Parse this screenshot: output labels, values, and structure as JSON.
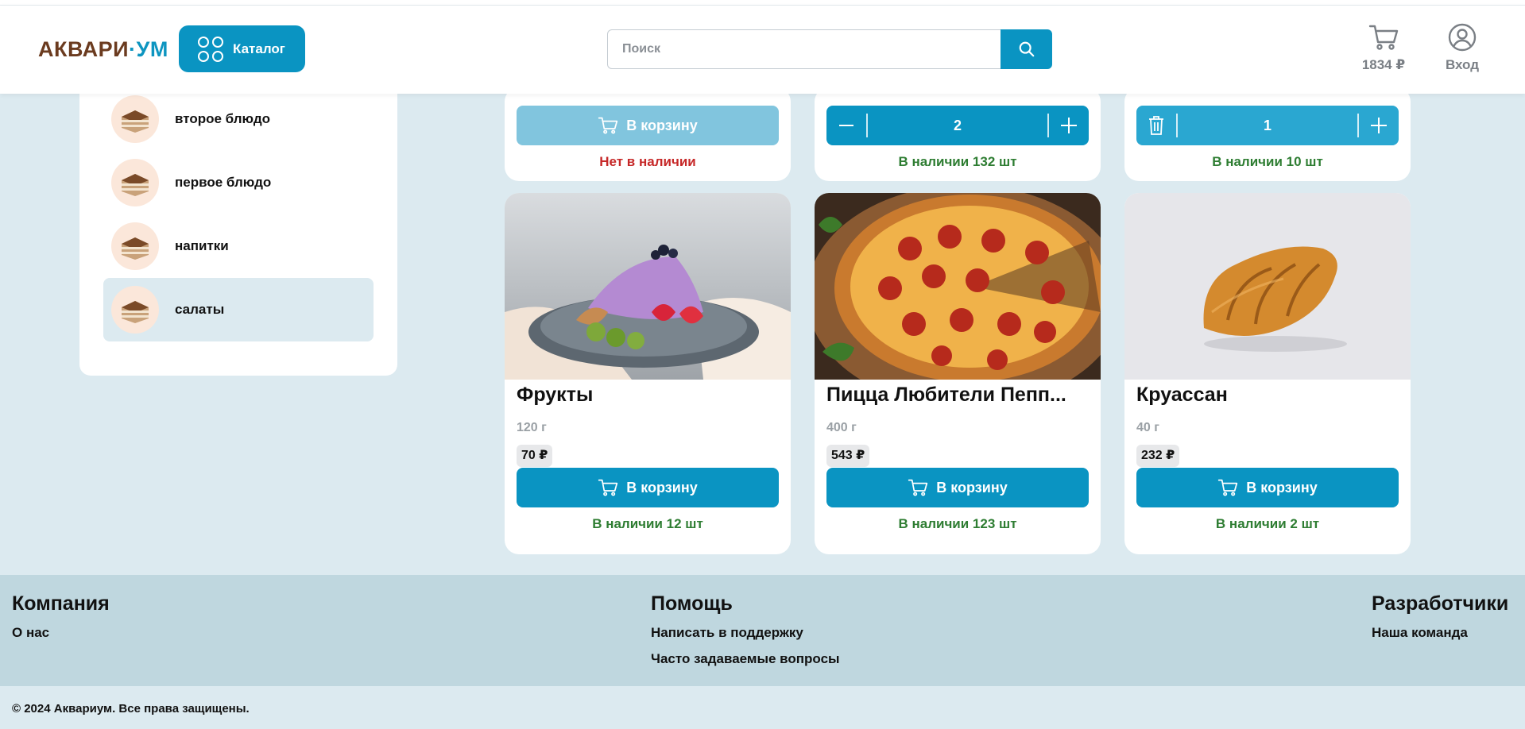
{
  "header": {
    "logo_part1": "АКВАРИ",
    "logo_dot": "·",
    "logo_part2": "УМ",
    "catalog_label": "Каталог",
    "search_placeholder": "Поиск",
    "cart_total": "1834 ₽",
    "login_label": "Вход",
    "colors": {
      "accent": "#0a94c2",
      "logo_brown": "#6b3b1f"
    }
  },
  "sidebar": {
    "items": [
      {
        "label": "второе блюдо",
        "icon": "tiramisu-thumb-icon",
        "active": false
      },
      {
        "label": "первое блюдо",
        "icon": "tiramisu-thumb-icon",
        "active": false
      },
      {
        "label": "напитки",
        "icon": "tiramisu-thumb-icon",
        "active": false
      },
      {
        "label": "салаты",
        "icon": "tiramisu-thumb-icon",
        "active": true
      }
    ]
  },
  "top_cards": [
    {
      "button_label": "В корзину",
      "stock": "Нет в наличии",
      "available": false
    },
    {
      "quantity": "2",
      "stock": "В наличии 132 шт",
      "available": true
    },
    {
      "quantity": "1",
      "stock": "В наличии 10 шт",
      "available": true
    }
  ],
  "products": [
    {
      "title": "Фрукты",
      "weight": "120 г",
      "price": "70 ₽",
      "button_label": "В корзину",
      "stock": "В наличии 12 шт",
      "image": "cake-with-berries-image"
    },
    {
      "title": "Пицца Любители Пепп...",
      "weight": "400 г",
      "price": "543 ₽",
      "button_label": "В корзину",
      "stock": "В наличии 123 шт",
      "image": "pepperoni-pizza-image"
    },
    {
      "title": "Круассан",
      "weight": "40 г",
      "price": "232 ₽",
      "button_label": "В корзину",
      "stock": "В наличии 2 шт",
      "image": "croissant-image"
    }
  ],
  "footer": {
    "company": {
      "title": "Компания",
      "links": [
        "О нас"
      ]
    },
    "help": {
      "title": "Помощь",
      "links": [
        "Написать в поддержку",
        "Часто задаваемые вопросы"
      ]
    },
    "developers": {
      "title": "Разработчики",
      "links": [
        "Наша команда"
      ]
    },
    "copyright": "© 2024 Аквариум. Все права защищены."
  }
}
